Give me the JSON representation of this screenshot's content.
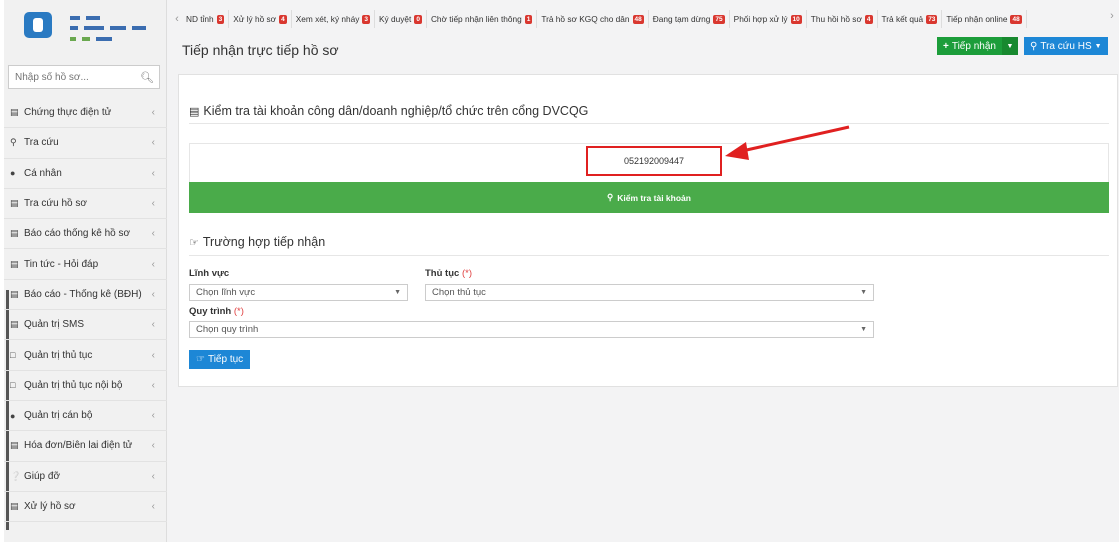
{
  "sidebar": {
    "search_placeholder": "Nhập số hồ sơ...",
    "items": [
      {
        "label": "Chứng thực điện tử",
        "icon": "list-icon"
      },
      {
        "label": "Tra cứu",
        "icon": "search-icon"
      },
      {
        "label": "Cá nhân",
        "icon": "user-icon"
      },
      {
        "label": "Tra cứu hồ sơ",
        "icon": "list-icon"
      },
      {
        "label": "Báo cáo thống kê hồ sơ",
        "icon": "list-icon"
      },
      {
        "label": "Tin tức - Hỏi đáp",
        "icon": "list-icon"
      },
      {
        "label": "Báo cáo - Thống kê (BĐH)",
        "icon": "list-icon"
      },
      {
        "label": "Quản trị SMS",
        "icon": "list-icon"
      },
      {
        "label": "Quản trị thủ tục",
        "icon": "document-icon"
      },
      {
        "label": "Quản trị thủ tục nội bộ",
        "icon": "document-icon"
      },
      {
        "label": "Quản trị cán bộ",
        "icon": "users-icon"
      },
      {
        "label": "Hóa đơn/Biên lai điện tử",
        "icon": "list-icon"
      },
      {
        "label": "Giúp đỡ",
        "icon": "help-icon"
      },
      {
        "label": "Xử lý hồ sơ",
        "icon": "list-icon"
      }
    ]
  },
  "topnav": {
    "tabs": [
      {
        "label": "ND tỉnh",
        "count": "3"
      },
      {
        "label": "Xử lý hồ sơ",
        "count": "4"
      },
      {
        "label": "Xem xét, ký nháy",
        "count": "3"
      },
      {
        "label": "Ký duyệt",
        "count": "0"
      },
      {
        "label": "Chờ tiếp nhận liên thông",
        "count": "1"
      },
      {
        "label": "Trả hồ sơ KGQ cho dân",
        "count": "48"
      },
      {
        "label": "Đang tạm dừng",
        "count": "75"
      },
      {
        "label": "Phối hợp xử lý",
        "count": "10"
      },
      {
        "label": "Thu hồi hồ sơ",
        "count": "4"
      },
      {
        "label": "Trả kết quả",
        "count": "73"
      },
      {
        "label": "Tiếp nhận online",
        "count": "48"
      }
    ]
  },
  "header": {
    "title": "Tiếp nhận trực tiếp hồ sơ",
    "receive_label": "Tiếp nhận",
    "lookup_label": "Tra cứu HS"
  },
  "main": {
    "check_title": "Kiểm tra tài khoản công dân/doanh nghiệp/tổ chức trên cổng DVCQG",
    "account_value": "052192009447",
    "check_button": "Kiểm tra tài khoản",
    "case_title": "Trường hợp tiếp nhận",
    "field_label": "Lĩnh vực",
    "field_select": "Chọn lĩnh vực",
    "procedure_label": "Thủ tục",
    "procedure_select": "Chọn thủ tục",
    "process_label": "Quy trình",
    "process_select": "Chọn quy trình",
    "required_mark": "(*)",
    "continue_button": "Tiếp tục"
  },
  "colors": {
    "annotation_red": "#e02020",
    "green": "#4aab4a",
    "blue": "#1d87d6"
  }
}
